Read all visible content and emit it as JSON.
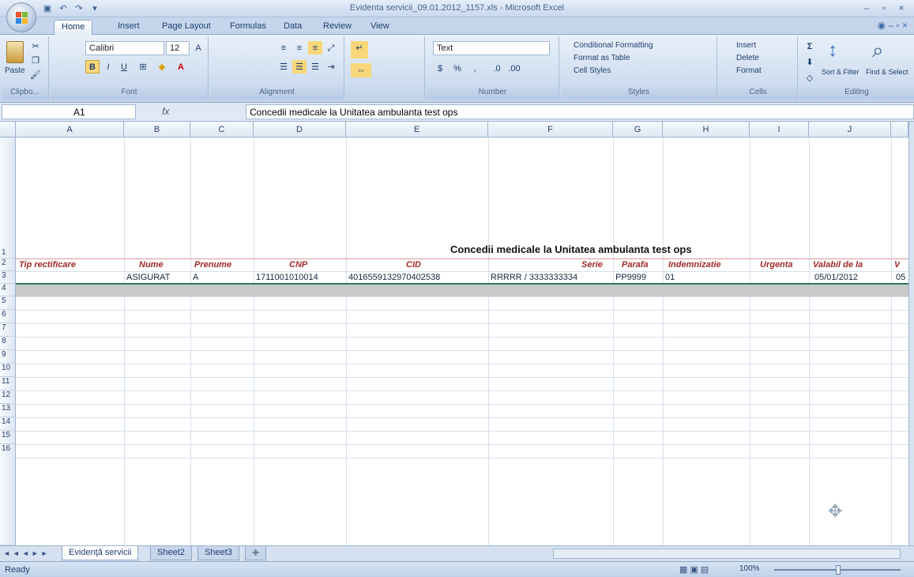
{
  "window": {
    "title": "Evidenta servicii_09.01.2012_1157.xls - Microsoft Excel",
    "controls": [
      "–",
      "▫",
      "×"
    ]
  },
  "quick_access": [
    "save-icon",
    "undo-icon",
    "redo-icon",
    "dropdown-icon"
  ],
  "tabs": [
    "Home",
    "Insert",
    "Page Layout",
    "Formulas",
    "Data",
    "Review",
    "View"
  ],
  "ribbon": {
    "clipboard": {
      "paste": "Paste",
      "label": "Clipbo..."
    },
    "font": {
      "name": "Calibri",
      "size": "12",
      "label": "Font",
      "bold": "B",
      "italic": "I",
      "underline": "U"
    },
    "alignment": {
      "label": "Alignment"
    },
    "number": {
      "format": "Text",
      "label": "Number",
      "currency": "$",
      "percent": "%",
      "comma": ","
    },
    "styles": {
      "conditional": "Conditional Formatting",
      "table": "Format as Table",
      "cell": "Cell Styles",
      "label": "Styles"
    },
    "cells": {
      "insert": "Insert",
      "delete": "Delete",
      "format": "Format",
      "label": "Cells"
    },
    "editing": {
      "sort": "Sort & Filter",
      "find": "Find & Select",
      "label": "Editing",
      "sigma": "Σ"
    }
  },
  "formula_bar": {
    "name_box": "A1",
    "fx": "fx",
    "content": "Concedii medicale la Unitatea ambulanta test ops"
  },
  "sheet": {
    "columns": [
      "A",
      "B",
      "C",
      "D",
      "E",
      "F",
      "G",
      "H",
      "I",
      "J"
    ],
    "rows": [
      "1",
      "2",
      "3",
      "4",
      "5",
      "6",
      "7",
      "8",
      "9",
      "10",
      "11",
      "12",
      "13",
      "14",
      "15",
      "16"
    ],
    "title": "Concedii medicale la Unitatea ambulanta test ops",
    "headers": [
      "Tip rectificare",
      "Nume",
      "Prenume",
      "CNP",
      "CID",
      "Serie",
      "Parafa",
      "Indemnizatie",
      "Urgenta",
      "Valabil de la",
      "V"
    ],
    "row3": [
      "",
      "ASIGURAT",
      "A",
      "1711001010014",
      "4016559132970402538",
      "RRRRR / 3333333334",
      "PP9999",
      "01",
      "",
      "05/01/2012",
      "05"
    ]
  },
  "sheet_tabs": [
    "Evidenţă servicii",
    "Sheet2",
    "Sheet3"
  ],
  "status": {
    "text": "Ready",
    "zoom": "100%"
  }
}
